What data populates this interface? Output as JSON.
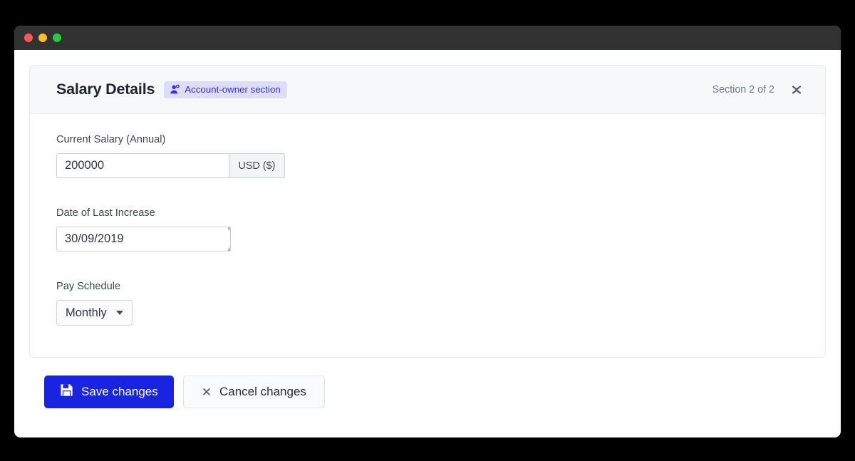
{
  "window": {
    "traffic_lights": [
      {
        "name": "close",
        "color": "#f75a54"
      },
      {
        "name": "minimize",
        "color": "#fbbd2e"
      },
      {
        "name": "maximize",
        "color": "#2bc840"
      }
    ]
  },
  "card": {
    "title": "Salary Details",
    "badge": {
      "label": "Account-owner section",
      "icon": "user-settings-icon",
      "bg": "#dcdcfb",
      "fg": "#3b30e8"
    },
    "section_counter": "Section 2 of 2",
    "collapse_icon": "collapse-icon"
  },
  "fields": [
    {
      "id": "current-salary",
      "label": "Current Salary (Annual)",
      "type": "text-with-suffix",
      "value": "200000",
      "placeholder": "",
      "suffix": "USD ($)"
    },
    {
      "id": "date-of-last-increase",
      "label": "Date of Last Increase",
      "type": "date",
      "value": "30/09/2019",
      "placeholder": "dd/mm/yyyy"
    },
    {
      "id": "pay-schedule",
      "label": "Pay Schedule",
      "type": "select",
      "value": "Monthly",
      "options": [
        "Monthly"
      ]
    }
  ],
  "footer": {
    "save_label": "Save changes",
    "save_icon": "save-floppy-icon",
    "cancel_label": "Cancel changes",
    "cancel_icon": "close-x-icon",
    "primary_color": "#1a24e0"
  }
}
